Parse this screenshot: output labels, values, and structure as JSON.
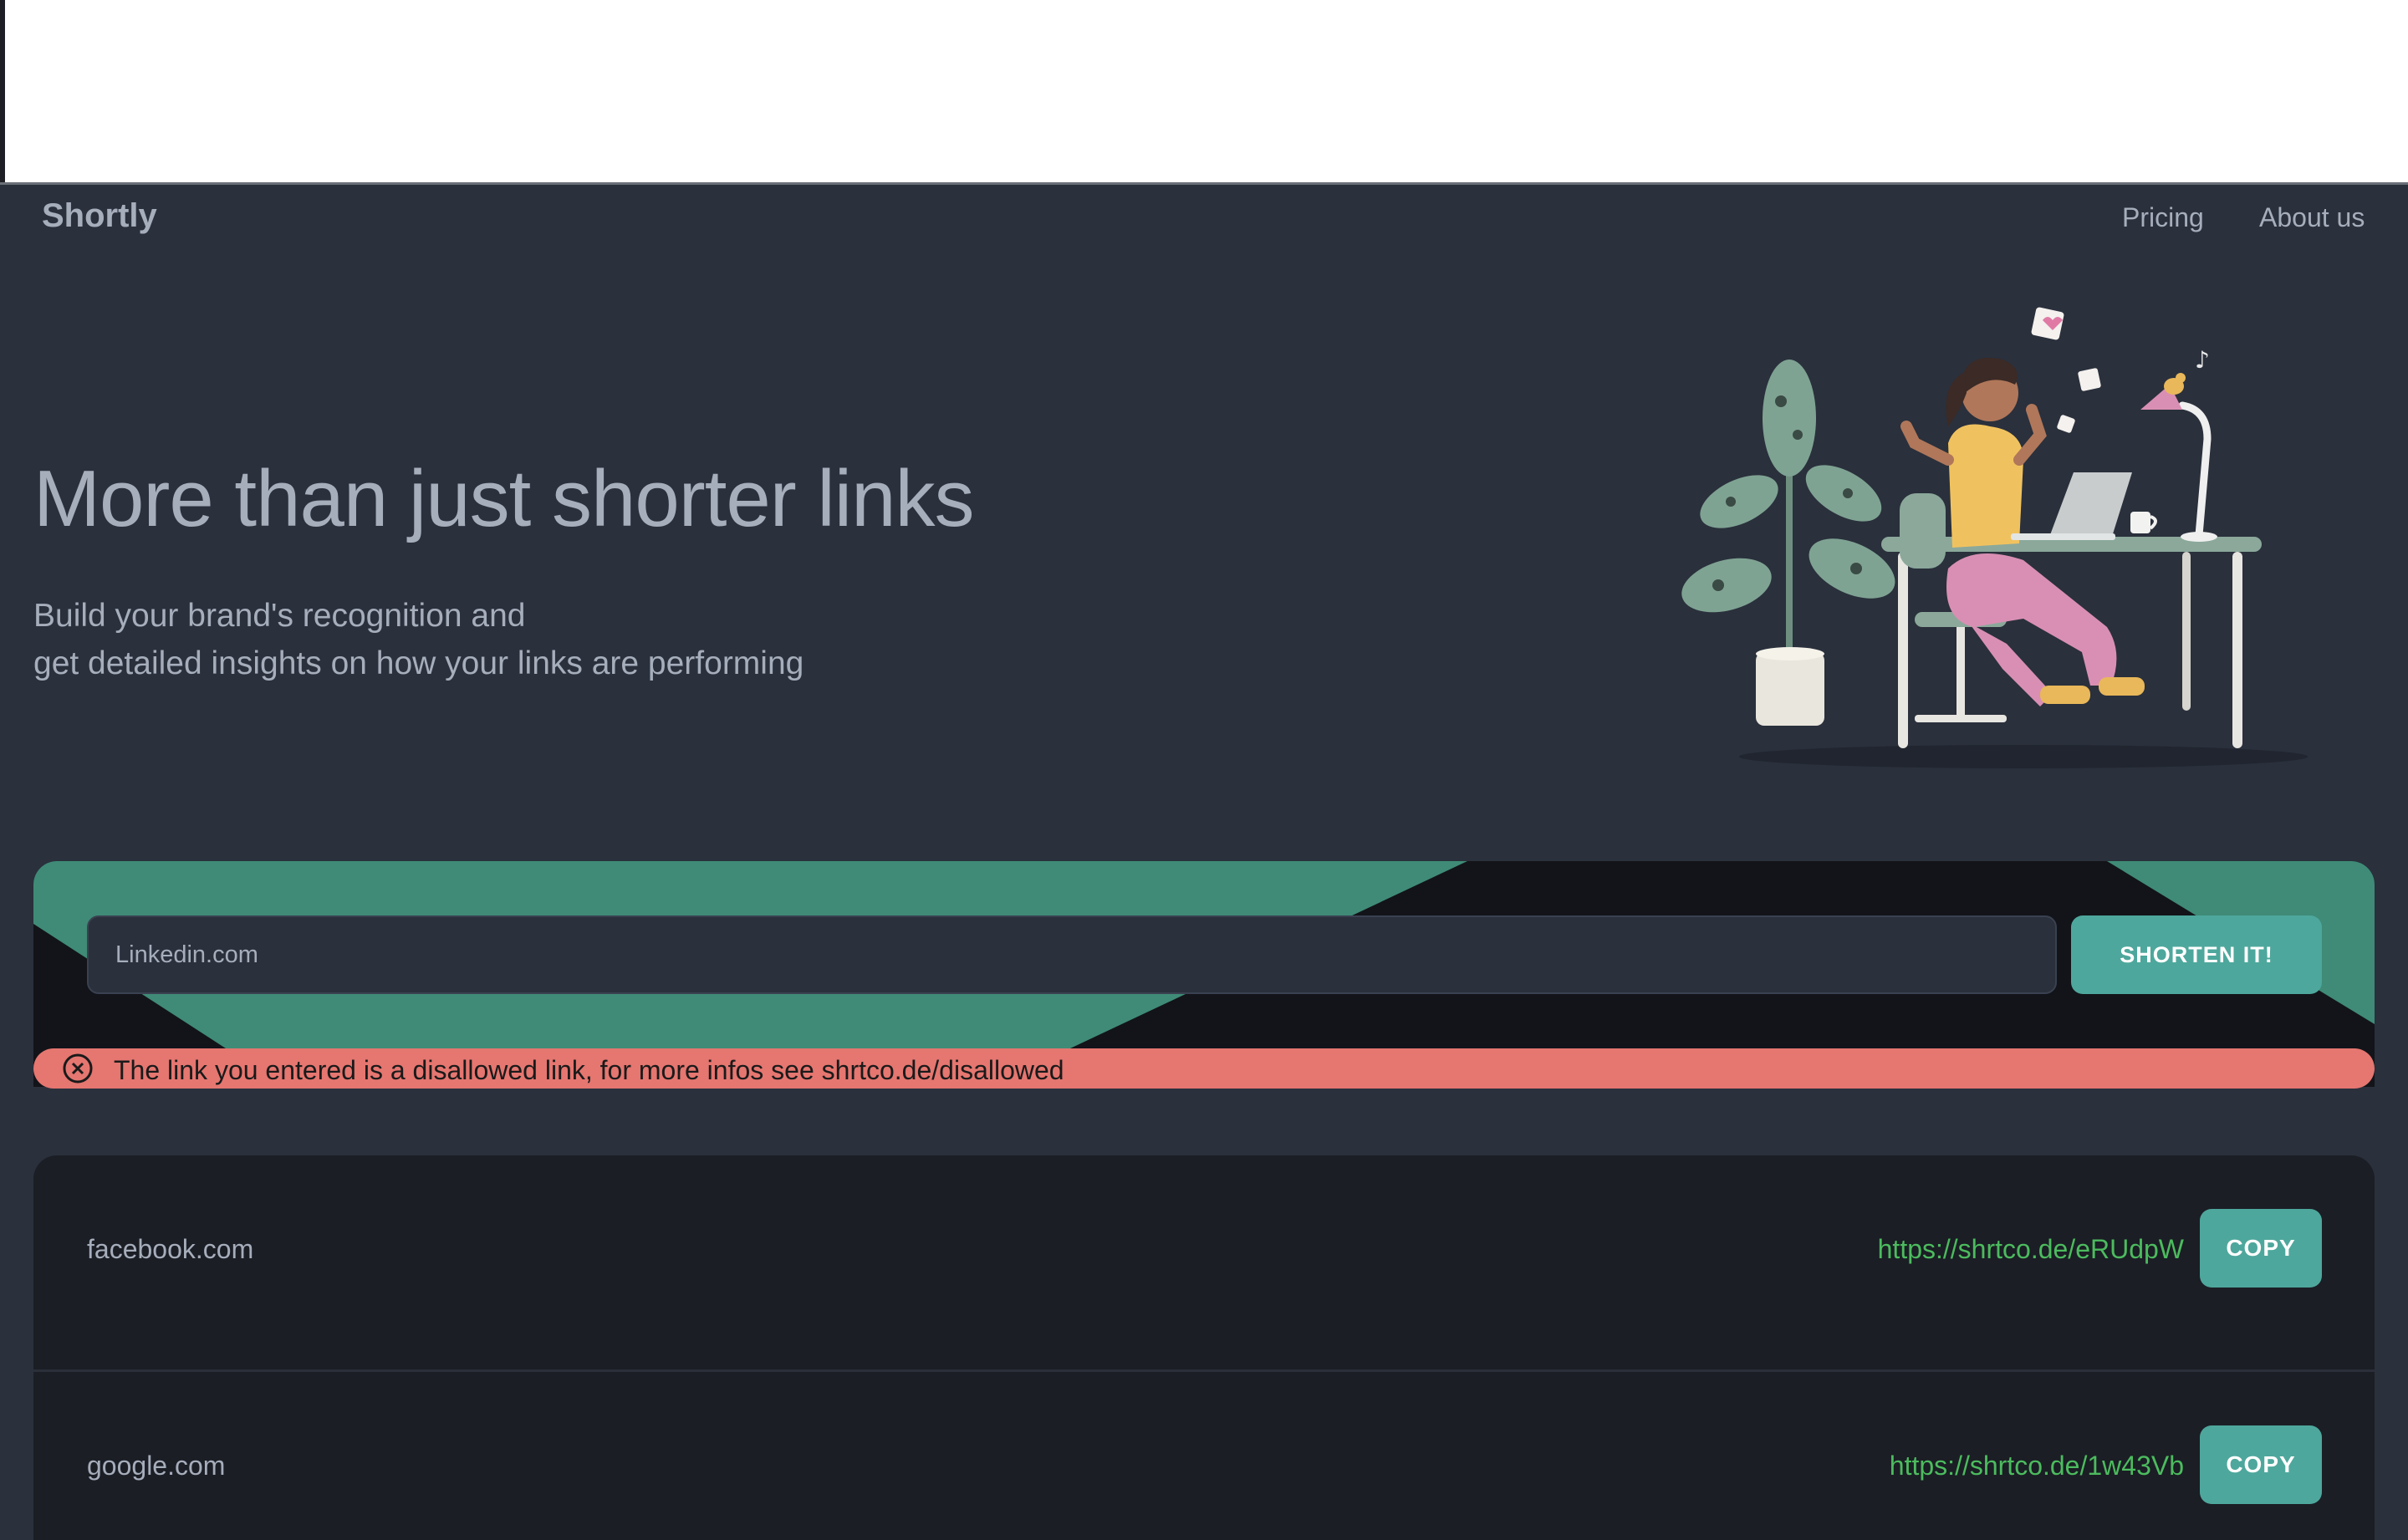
{
  "nav": {
    "brand": "Shortly",
    "links": [
      "Pricing",
      "About us"
    ]
  },
  "hero": {
    "title": "More than just shorter links",
    "subtitle_line1": "Build your brand's recognition and",
    "subtitle_line2": "get detailed insights on how your links are performing",
    "illustration": "woman-working-at-desk-illustration"
  },
  "shortener": {
    "input_value": "Linkedin.com",
    "button_label": "SHORTEN IT!",
    "error_icon": "circle-x-icon",
    "error_message": "The link you entered is a disallowed link, for more infos see shrtco.de/disallowed"
  },
  "results": [
    {
      "original": "facebook.com",
      "short": "https://shrtco.de/eRUdpW",
      "copy_label": "COPY"
    },
    {
      "original": "google.com",
      "short": "https://shrtco.de/1w43Vb",
      "copy_label": "COPY"
    }
  ],
  "colors": {
    "page_bg": "#2a303c",
    "accent": "#4ea79c",
    "error": "#e57670",
    "link_green": "#4cbb5e",
    "card_bg": "#1b1e25"
  }
}
